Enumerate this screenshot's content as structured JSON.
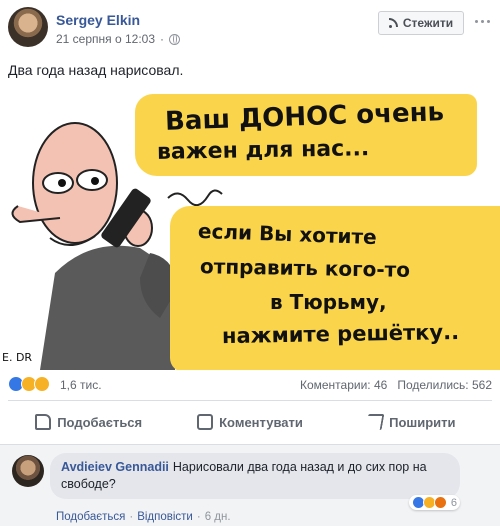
{
  "post": {
    "author": "Sergey Elkin",
    "date": "21 серпня о 12:03",
    "separator": "·",
    "follow_label": "Стежити",
    "text": "Два года назад нарисовал."
  },
  "cartoon": {
    "bubble1": [
      "Ваш ДОНОС очень",
      "важен для нас..."
    ],
    "bubble2": [
      "если Вы хотите",
      "отправить кого-то",
      "в Тюрьму,",
      "нажмите решётку.."
    ],
    "signature": "Е. DR"
  },
  "stats": {
    "reactions_count": "1,6 тис.",
    "comments": "Коментарии: 46",
    "shares": "Поделились: 562"
  },
  "actions": {
    "like": "Подобається",
    "comment": "Коментувати",
    "share": "Поширити"
  },
  "comment": {
    "author": "Avdieiev Gennadii",
    "text": "Нарисовали два года назад и до сих пор на свободе?",
    "reaction_count": "6",
    "like_link": "Подобається",
    "reply_link": "Відповісти",
    "time": "6 дн.",
    "dot": "·"
  },
  "colors": {
    "link": "#385898",
    "bubble_yellow": "#fad44a",
    "like_blue": "#3578e5"
  }
}
